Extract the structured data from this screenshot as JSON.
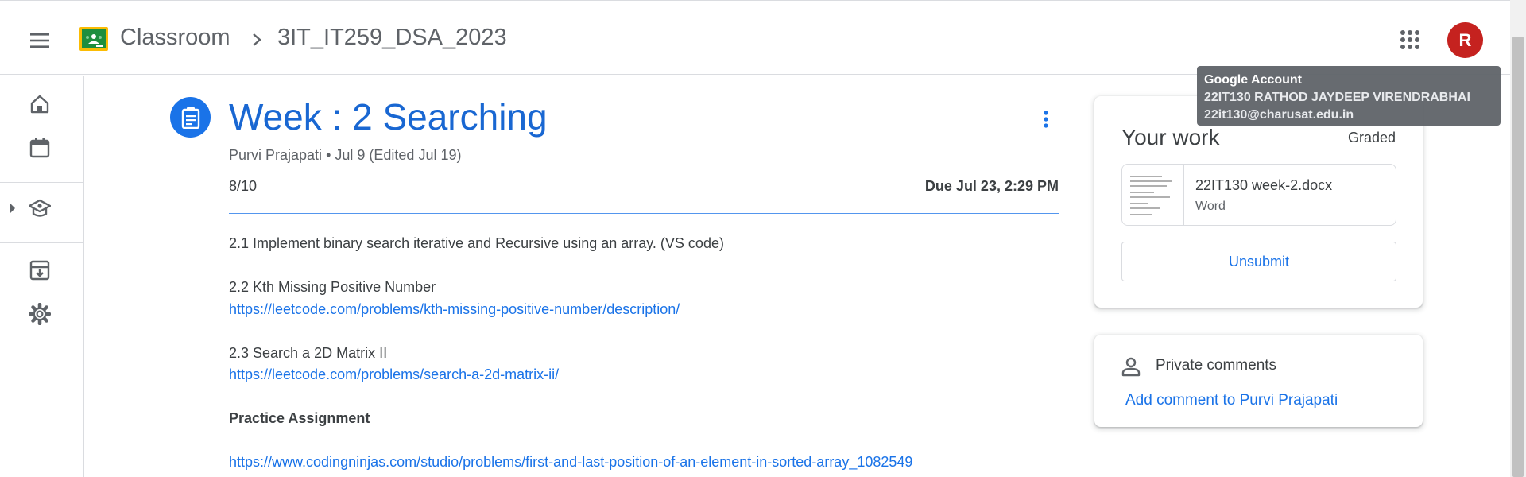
{
  "header": {
    "brand": "Classroom",
    "course": "3IT_IT259_DSA_2023",
    "avatar_initial": "R",
    "avatar_color": "#c5221f"
  },
  "tooltip": {
    "title": "Google Account",
    "name": "22IT130 RATHOD JAYDEEP VIRENDRABHAI",
    "email": "22it130@charusat.edu.in"
  },
  "rail": {
    "icons": [
      "home-icon",
      "calendar-icon",
      "enrolled-icon",
      "todo-icon",
      "settings-icon"
    ]
  },
  "assignment": {
    "title": "Week : 2 Searching",
    "author": "Purvi Prajapati",
    "date": "Jul 9 (Edited Jul 19)",
    "points": "8/10",
    "due": "Due Jul 23, 2:29 PM",
    "description": [
      {
        "text": "2.1 Implement binary search iterative and Recursive using an array. (VS code)",
        "type": "text"
      },
      {
        "text": "2.2 Kth Missing Positive Number",
        "type": "text"
      },
      {
        "text": "https://leetcode.com/problems/kth-missing-positive-number/description/",
        "type": "link"
      },
      {
        "text": "2.3 Search a 2D Matrix II",
        "type": "text"
      },
      {
        "text": "https://leetcode.com/problems/search-a-2d-matrix-ii/",
        "type": "link"
      },
      {
        "text": "Practice Assignment",
        "type": "bold"
      },
      {
        "text": "https://www.codingninjas.com/studio/problems/first-and-last-position-of-an-element-in-sorted-array_1082549",
        "type": "link"
      }
    ]
  },
  "your_work": {
    "title": "Your work",
    "status": "Graded",
    "attachment_name": "22IT130 week-2.docx",
    "attachment_type": "Word",
    "unsubmit_label": "Unsubmit"
  },
  "comments": {
    "title": "Private comments",
    "add_label": "Add comment to Purvi Prajapati"
  },
  "colors": {
    "accent": "#1a73e8",
    "title_blue": "#1967d2",
    "classroom_green": "#1e8e3e",
    "classroom_yellow": "#fbbc04"
  }
}
